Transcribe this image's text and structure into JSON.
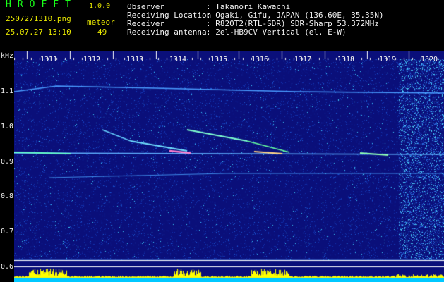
{
  "app": {
    "title": "HROFFT",
    "version": "1.0.0"
  },
  "file_name": "2507271310.png",
  "timestamp": "25.07.27 13:10",
  "meteor": {
    "label": "meteor",
    "count": "49"
  },
  "info": [
    {
      "label": "Observer",
      "value": ": Takanori Kawachi"
    },
    {
      "label": "Receiving Location",
      "value": ": Ogaki, Gifu, JAPAN (136.60E, 35.35N)"
    },
    {
      "label": "Receiver",
      "value": ": R820T2(RTL-SDR) SDR-Sharp 53.372MHz"
    },
    {
      "label": "Receiving antenna",
      "value": ": 2el-HB9CV Vertical (el. E-W)"
    }
  ],
  "y_axis": {
    "unit": "kHz",
    "ticks": [
      "1.1",
      "1.0",
      "0.9",
      "0.8",
      "0.7",
      "0.6"
    ]
  },
  "x_axis": {
    "ticks": [
      "1311",
      "1312",
      "1313",
      "1314",
      "1315",
      "1316",
      "1317",
      "1318",
      "1319",
      "1320"
    ]
  },
  "colors": {
    "title": "#19ff19",
    "label": "#e6e600",
    "info": "#f2f2f2",
    "background": "#0a0f7a",
    "band": "#00c8ff",
    "activity": "#ffff00"
  }
}
